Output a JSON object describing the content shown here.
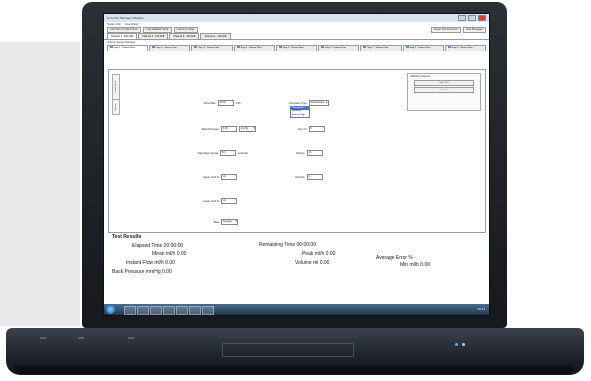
{
  "window": {
    "title": "D-Vu Pro Manager Window",
    "menu": [
      "System Info",
      "View (View)"
    ],
    "toolbar_left": [
      "Load New Constant Mode",
      "Load Validation Mode",
      "Load Error Mode"
    ],
    "toolbar_right": [
      "Export Test Document",
      "Clear Messages"
    ]
  },
  "channel_tabs": [
    {
      "label": "Channel 1 - 100 AVE",
      "active": true
    },
    {
      "label": "Channel 2 - 100 AVE",
      "active": false
    },
    {
      "label": "Channel 3 - 100 AVE",
      "active": false
    },
    {
      "label": "Channel 4 - 100 AVE",
      "active": false
    }
  ],
  "section_label": "Volume Sensor Manager",
  "step_tabs": [
    {
      "label": "Step 1 - Volume Flow",
      "active": true
    },
    {
      "label": "Step 2 - Secure Time",
      "active": false
    },
    {
      "label": "Step 3 - Volume Flow",
      "active": false
    },
    {
      "label": "Step 4 - Volume Flow",
      "active": false
    },
    {
      "label": "Step 5 - Volume Flow",
      "active": false
    },
    {
      "label": "Step 6 - Volume Flow",
      "active": false
    },
    {
      "label": "Step 7 - Volume Flow",
      "active": false
    },
    {
      "label": "Step 8 - Volume Flow",
      "active": false
    },
    {
      "label": "Step 9 - Volume Flow",
      "active": false
    }
  ],
  "vertical_tabs": [
    "Test Method",
    "Custom"
  ],
  "form": {
    "flow_rate": {
      "label": "Flow Rate",
      "value": "20.00",
      "unit": "ml/h"
    },
    "back_pressure": {
      "label": "Back Pressure",
      "value": "0.00",
      "select": "mmHg"
    },
    "sampling_interval": {
      "label": "Sampling Interval",
      "value": "30",
      "unit": "seconds"
    },
    "upper_limit": {
      "label": "Upper Limit %",
      "value": "10"
    },
    "lower_limit": {
      "label": "Lower Limit %",
      "value": "10"
    },
    "bias": {
      "label": "Bias",
      "select": "Average"
    },
    "occlusion_type": {
      "label": "Occlusion Type",
      "select": "Downstream"
    },
    "occlusion_options": [
      "Downstream",
      "Upstream",
      "Infusion Stop"
    ],
    "num_a": {
      "label": "Num %",
      "value": "0"
    },
    "volume": {
      "label": "Volume",
      "value": "10"
    },
    "occlude": {
      "label": "Occlude",
      "value": "0"
    }
  },
  "side_panel": {
    "header": "Validation Channel",
    "buttons": [
      "Start Test",
      "Stop Test"
    ]
  },
  "results": {
    "title": "Test Results",
    "elapsed": "Elapsed Time 00:00:00",
    "remaining": "Remaining Time 00:00:00",
    "mean": "Mean ml/h 0.00",
    "peak": "Peak ml/h 0.00",
    "avg_error": "Average Error % -",
    "instant": "Instant Flow ml/h 0.00",
    "volume": "Volume ml 0.00",
    "min": "Min ml/h 0.00",
    "back_pressure": "Back Pressure mmHg 0.00"
  },
  "taskbar": {
    "clock": "10:14"
  },
  "laptop": {
    "ports": [
      "",
      "",
      ""
    ]
  }
}
